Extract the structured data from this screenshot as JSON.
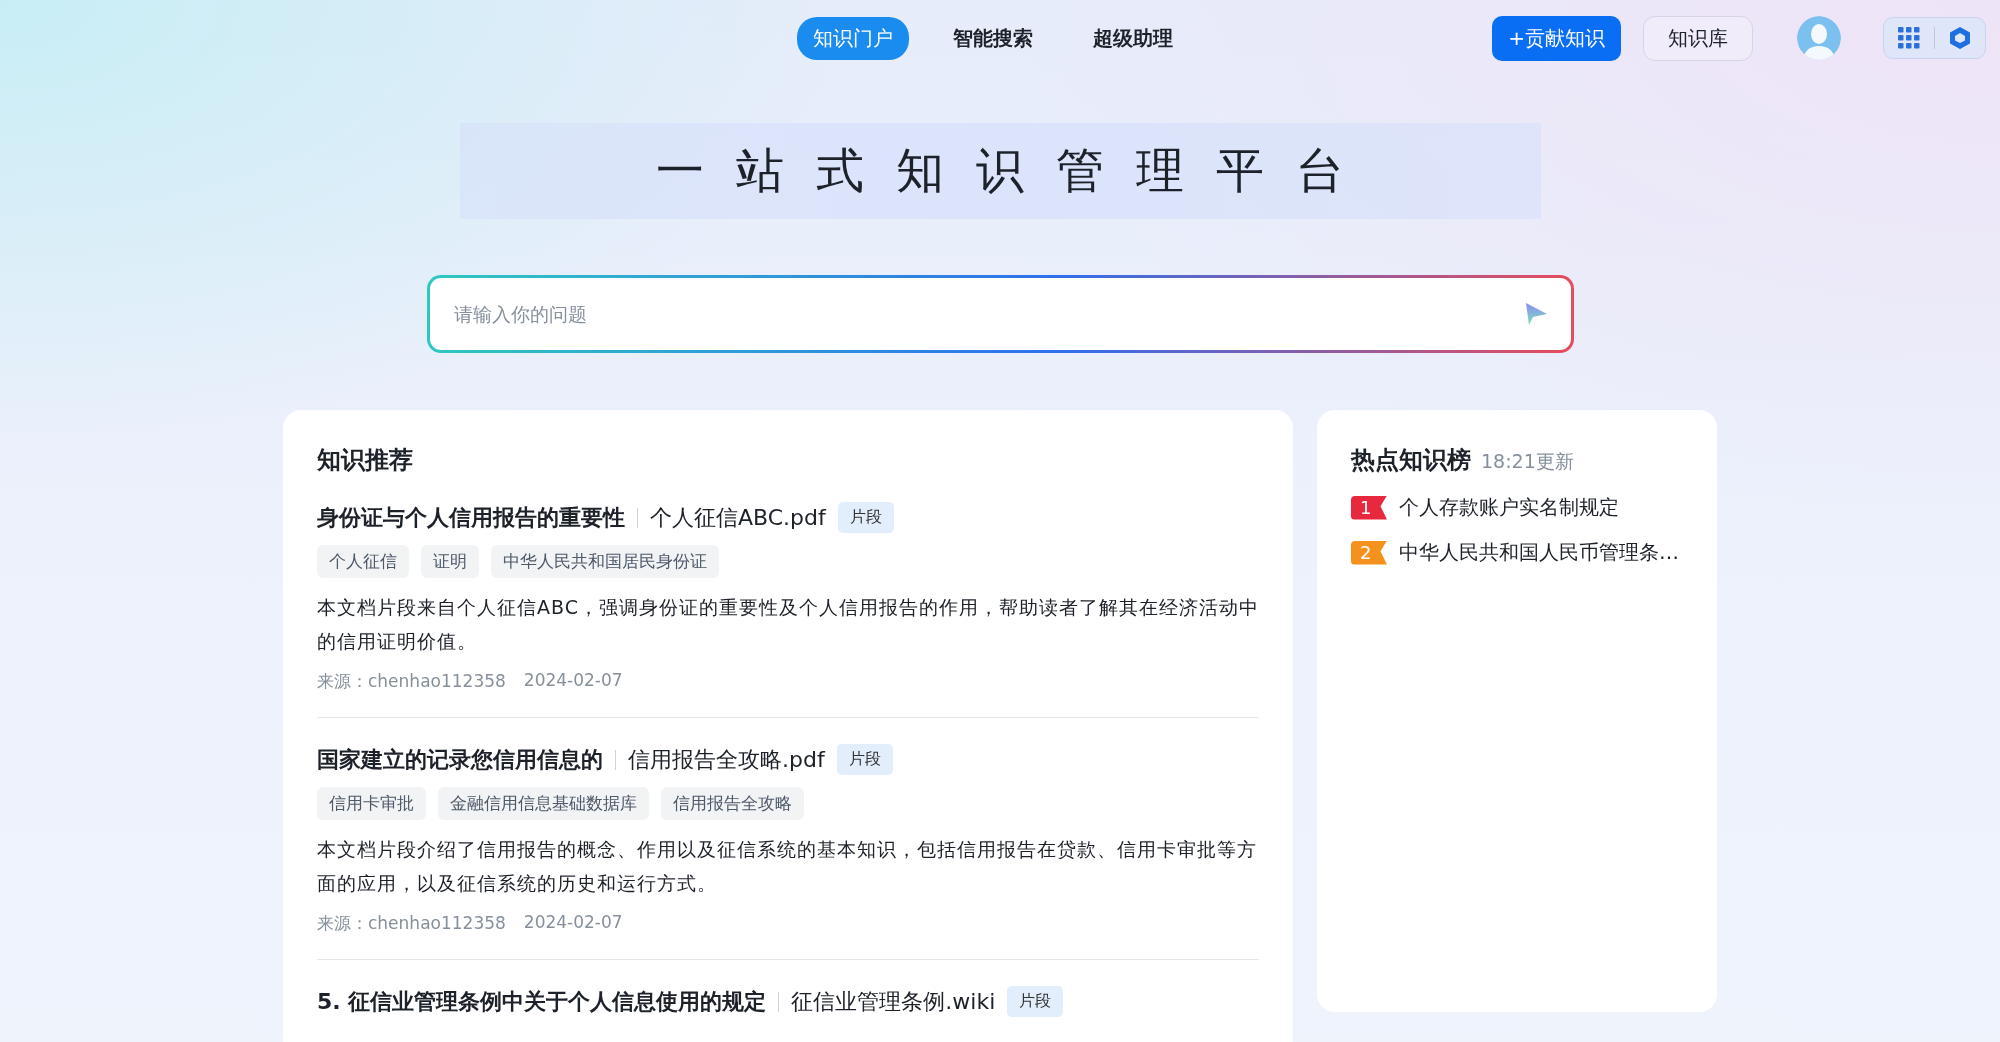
{
  "nav": {
    "tabs": [
      {
        "label": "知识门户",
        "selected": true
      },
      {
        "label": "智能搜索",
        "selected": false
      },
      {
        "label": "超级助理",
        "selected": false
      }
    ],
    "contribute_button": "+贡献知识",
    "library_button": "知识库"
  },
  "hero": {
    "title": "一站式知识管理平台"
  },
  "search": {
    "placeholder": "请输入你的问题"
  },
  "recommend": {
    "title": "知识推荐",
    "items": [
      {
        "title": "身份证与个人信用报告的重要性",
        "file": "个人征信ABC.pdf",
        "badge": "片段",
        "tags": [
          "个人征信",
          "证明",
          "中华人民共和国居民身份证"
        ],
        "summary": "本文档片段来自个人征信ABC，强调身份证的重要性及个人信用报告的作用，帮助读者了解其在经济活动中的信用证明价值。",
        "source": "来源：chenhao112358",
        "date": "2024-02-07"
      },
      {
        "title": "国家建立的记录您信用信息的",
        "file": "信用报告全攻略.pdf",
        "badge": "片段",
        "tags": [
          "信用卡审批",
          "金融信用信息基础数据库",
          "信用报告全攻略"
        ],
        "summary": "本文档片段介绍了信用报告的概念、作用以及征信系统的基本知识，包括信用报告在贷款、信用卡审批等方面的应用，以及征信系统的历史和运行方式。",
        "source": "来源：chenhao112358",
        "date": "2024-02-07"
      },
      {
        "title": "5. 征信业管理条例中关于个人信息使用的规定",
        "file": "征信业管理条例.wiki",
        "badge": "片段"
      }
    ]
  },
  "hot": {
    "title": "热点知识榜",
    "updated": "18:21更新",
    "items": [
      {
        "rank": "1",
        "text": "个人存款账户实名制规定",
        "color": "#e8283c"
      },
      {
        "rank": "2",
        "text": "中华人民共和国人民币管理条…",
        "color": "#f5921e"
      }
    ]
  }
}
